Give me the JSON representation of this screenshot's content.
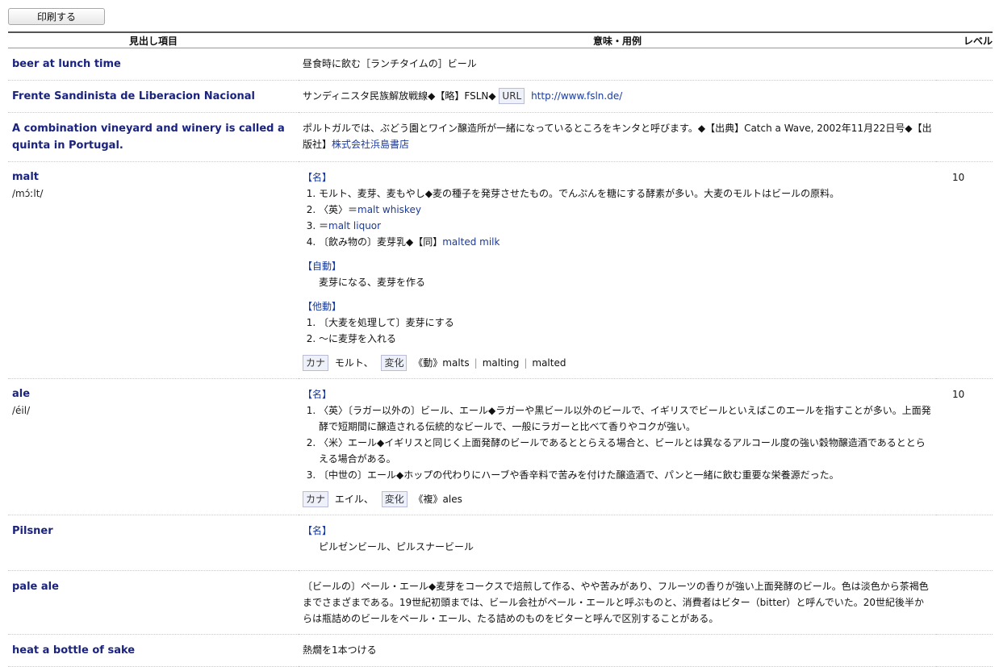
{
  "toolbar": {
    "print_label": "印刷する"
  },
  "columns": {
    "entry": "見出し項目",
    "meaning": "意味・用例",
    "level": "レベル"
  },
  "entries": [
    {
      "word": "beer at lunch time",
      "meaning": "昼食時に飲む［ランチタイムの］ビール"
    },
    {
      "word": "Frente Sandinista de Liberacion Nacional",
      "meaning": "サンディニスタ民族解放戦線◆【略】FSLN◆",
      "url_tag": "URL",
      "url": "http://www.fsln.de/"
    },
    {
      "word": "A combination vineyard and winery is called a quinta in Portugal.",
      "meaning": "ポルトガルでは、ぶどう園とワイン醸造所が一緒になっているところをキンタと呼びます。◆【出典】Catch a Wave, 2002年11月22日号◆【出版社】",
      "publisher": "株式会社浜島書店"
    },
    {
      "word": "malt",
      "pron": "/mɔ́ːlt/",
      "level": "10",
      "pos1": "【名】",
      "s1": "モルト、麦芽、麦もやし◆麦の種子を発芽させたもの。でんぷんを糖にする酵素が多い。大麦のモルトはビールの原料。",
      "s2_prefix": "〈英〉＝",
      "s2_link": "malt whiskey",
      "s3_prefix": "＝",
      "s3_link": "malt liquor",
      "s4_prefix": "〔飲み物の〕麦芽乳◆【同】",
      "s4_link": "malted milk",
      "pos2": "【自動】",
      "p2": "麦芽になる、麦芽を作る",
      "pos3": "【他動】",
      "t1": "〔大麦を処理して〕麦芽にする",
      "t2": "～に麦芽を入れる",
      "kana_tag": "カナ",
      "kana": "モルト、",
      "change_tag": "変化",
      "forms_label": "《動》",
      "f1": "malts",
      "f2": "malting",
      "f3": "malted"
    },
    {
      "word": "ale",
      "pron": "/éil/",
      "level": "10",
      "pos1": "【名】",
      "s1": "〈英〉〔ラガー以外の〕ビール、エール◆ラガーや黒ビール以外のビールで、イギリスでビールといえばこのエールを指すことが多い。上面発酵で短期間に醸造される伝統的なビールで、一般にラガーと比べて香りやコクが強い。",
      "s2": "〈米〉エール◆イギリスと同じく上面発酵のビールであるととらえる場合と、ビールとは異なるアルコール度の強い穀物醸造酒であるととらえる場合がある。",
      "s3": "〔中世の〕エール◆ホップの代わりにハーブや香辛料で苦みを付けた醸造酒で、パンと一緒に飲む重要な栄養源だった。",
      "kana_tag": "カナ",
      "kana": "エイル、",
      "change_tag": "変化",
      "forms_label": "《複》",
      "f1": "ales"
    },
    {
      "word": "Pilsner",
      "pos1": "【名】",
      "p1": "ピルゼンビール、ピルスナービール"
    },
    {
      "word": "pale ale",
      "meaning": "〔ビールの〕ペール・エール◆麦芽をコークスで焙煎して作る、やや苦みがあり、フルーツの香りが強い上面発酵のビール。色は淡色から茶褐色までさまざまである。19世紀初頭までは、ビール会社がペール・エールと呼ぶものと、消費者はビター（bitter）と呼んでいた。20世紀後半からは瓶詰めのビールをペール・エール、たる詰めのものをビターと呼んで区別することがある。"
    },
    {
      "word": "heat a bottle of sake",
      "meaning": "熱燗を1本つける"
    }
  ]
}
